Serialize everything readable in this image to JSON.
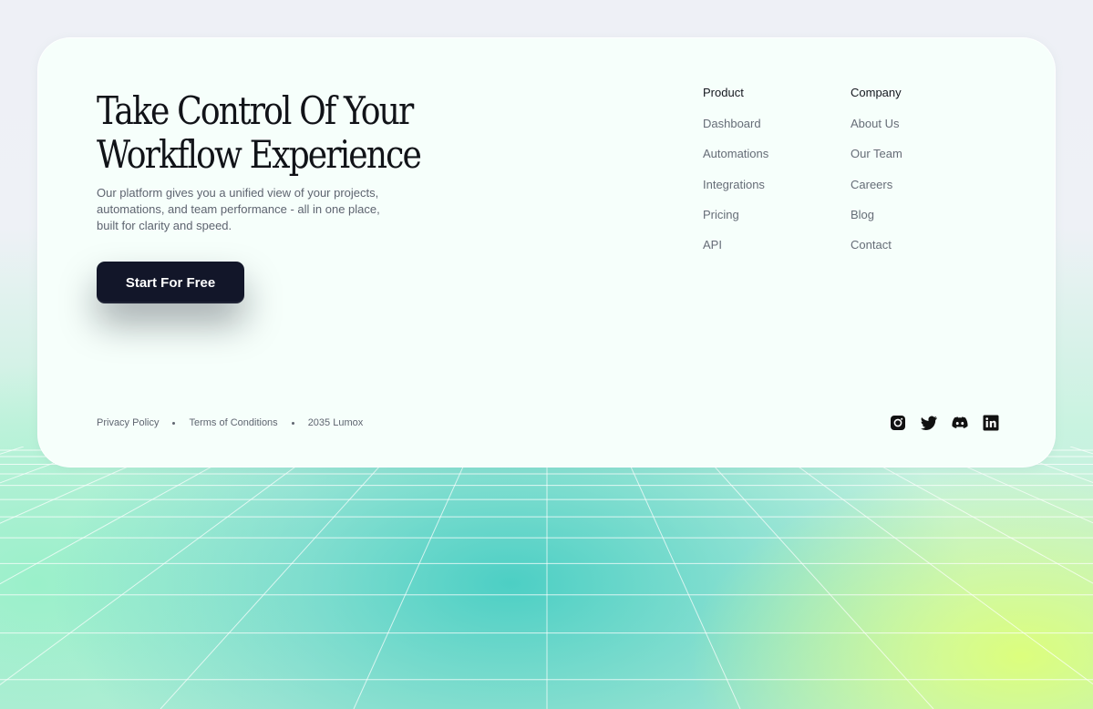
{
  "hero": {
    "title_line1": "Take Control Of Your",
    "title_line2": "Workflow Experience",
    "description": "Our platform gives you a unified view of your projects, automations, and team performance - all in one place, built for clarity and speed.",
    "cta_label": "Start For Free"
  },
  "nav": {
    "product": {
      "heading": "Product",
      "links": [
        "Dashboard",
        "Automations",
        "Integrations",
        "Pricing",
        "API"
      ]
    },
    "company": {
      "heading": "Company",
      "links": [
        "About Us",
        "Our Team",
        "Careers",
        "Blog",
        "Contact"
      ]
    }
  },
  "footer": {
    "privacy": "Privacy Policy",
    "terms": "Terms of Conditions",
    "copyright": "2035 Lumox"
  },
  "socials": [
    "instagram-icon",
    "twitter-icon",
    "discord-icon",
    "linkedin-icon"
  ],
  "colors": {
    "card_bg": "#f6fffb",
    "cta_bg": "#121629",
    "heading": "#111318",
    "muted": "#666c77"
  }
}
